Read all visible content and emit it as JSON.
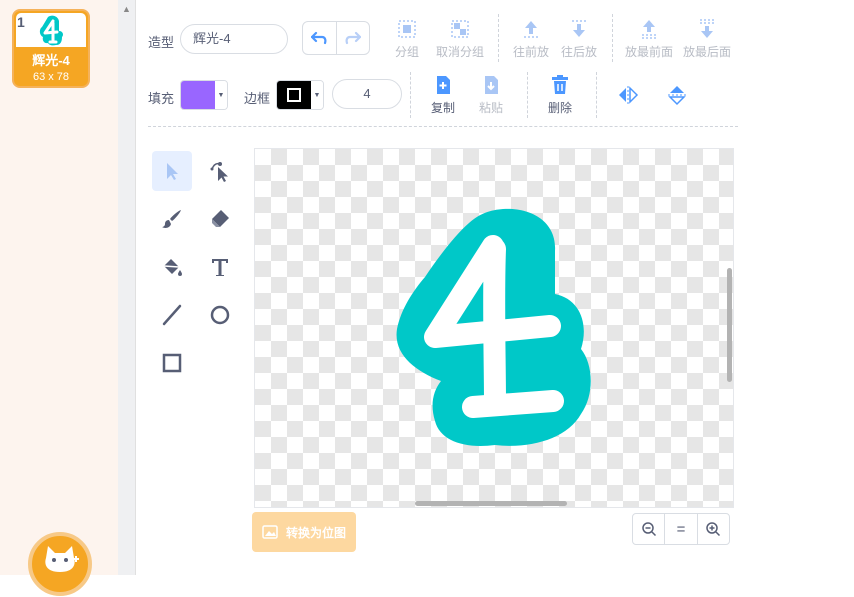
{
  "costume_list": {
    "items": [
      {
        "index": "1",
        "name": "辉光-4",
        "size": "63 x 78"
      }
    ]
  },
  "toolbar": {
    "costume_label": "造型",
    "costume_name": "辉光-4",
    "group": "分组",
    "ungroup": "取消分组",
    "forward": "往前放",
    "backward": "往后放",
    "front": "放最前面",
    "back": "放最后面",
    "fill_label": "填充",
    "fill_color": "#9966ff",
    "outline_label": "边框",
    "outline_color": "#000000",
    "outline_width": "4",
    "copy": "复制",
    "paste": "粘贴",
    "delete": "删除"
  },
  "canvas": {
    "glyph": "4",
    "glyph_fill": "#ffffff",
    "glow_color": "#00c8c8"
  },
  "bottom": {
    "convert_bitmap": "转换为位图",
    "zoom_reset": "="
  },
  "colors": {
    "accent": "#f5a623",
    "icon_blue": "#4c97ff"
  }
}
